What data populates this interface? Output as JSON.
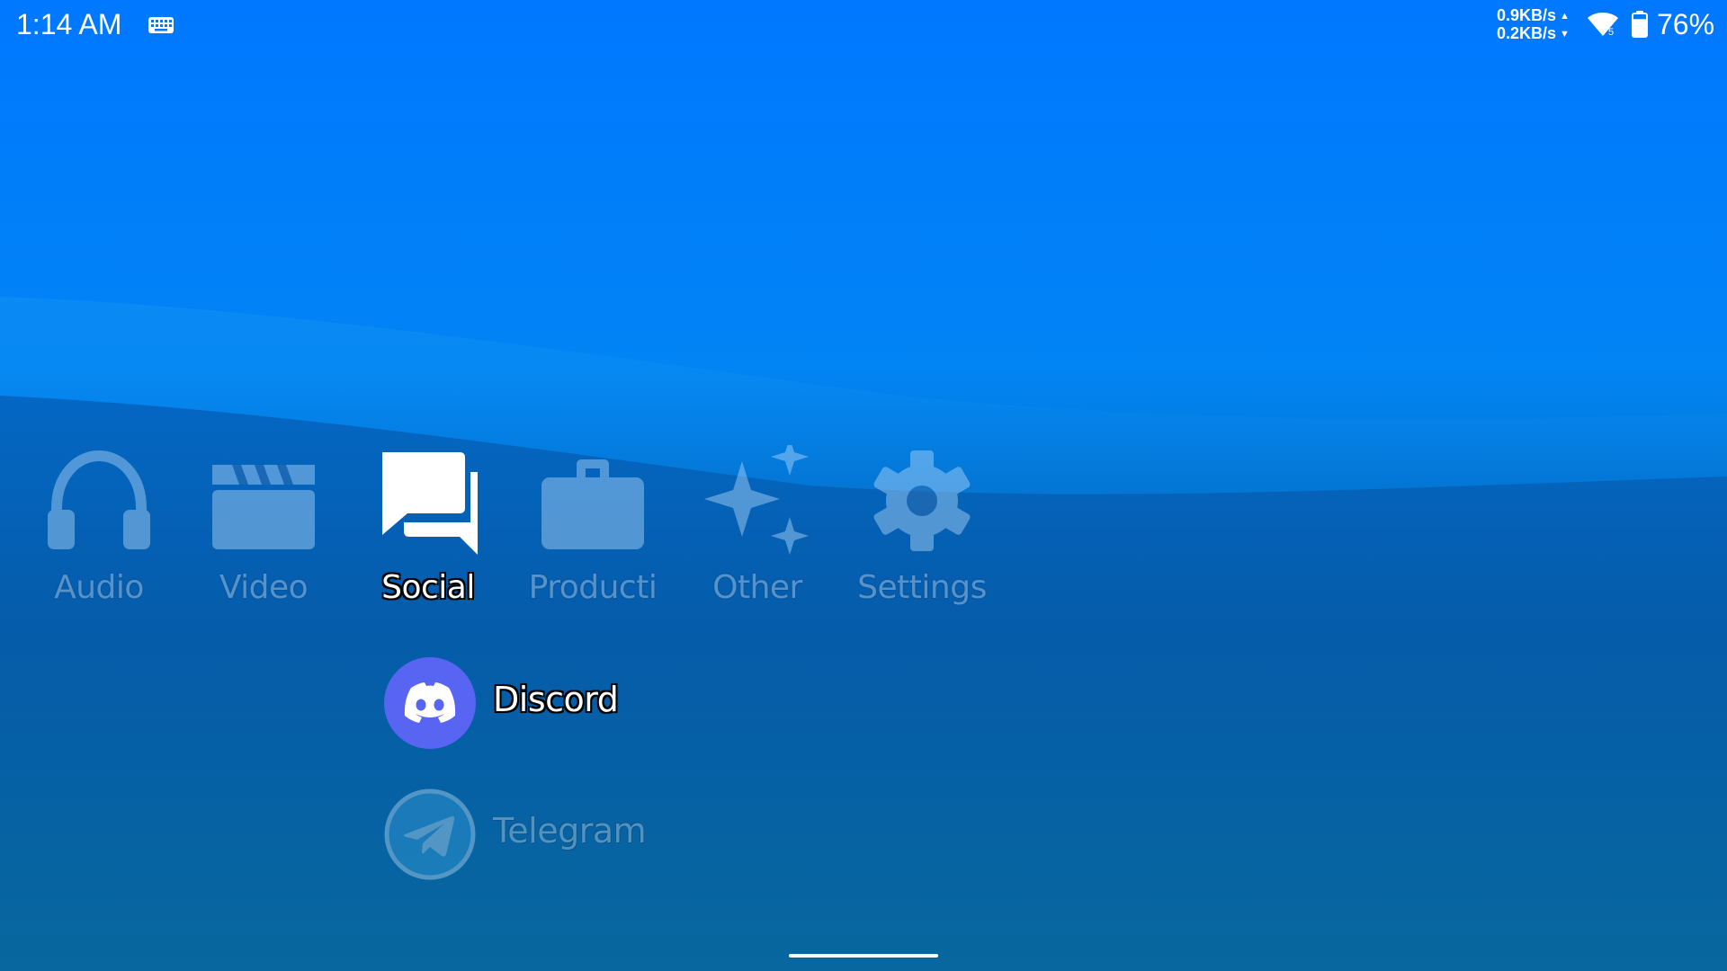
{
  "status_bar": {
    "time": "1:14 AM",
    "keyboard_icon": "keyboard-icon",
    "upload_speed": "0.9KB/s",
    "upload_arrow": "▲",
    "download_speed": "0.2KB/s",
    "download_arrow": "▼",
    "wifi_icon": "wifi-icon",
    "wifi_band": "5",
    "battery_icon": "battery-icon",
    "battery_level_fraction": 0.76,
    "battery_percent": "76%"
  },
  "categories": [
    {
      "label": "Audio",
      "icon": "headphones-icon",
      "selected": false
    },
    {
      "label": "Video",
      "icon": "clapperboard-icon",
      "selected": false
    },
    {
      "label": "Social",
      "icon": "chat-bubbles-icon",
      "selected": true
    },
    {
      "label": "Producti",
      "icon": "briefcase-icon",
      "selected": false
    },
    {
      "label": "Other",
      "icon": "sparkles-icon",
      "selected": false
    },
    {
      "label": "Settings",
      "icon": "gear-icon",
      "selected": false
    }
  ],
  "apps": [
    {
      "label": "Discord",
      "icon": "discord-icon",
      "selected": true,
      "color": "#5865f2"
    },
    {
      "label": "Telegram",
      "icon": "telegram-icon",
      "selected": false,
      "color": "#2a9fd6"
    }
  ],
  "colors": {
    "background_top": "#0078ff",
    "background_bottom": "#06659f",
    "discord_blurple": "#5865f2",
    "text": "#ffffff"
  },
  "home_indicator": "home-indicator"
}
